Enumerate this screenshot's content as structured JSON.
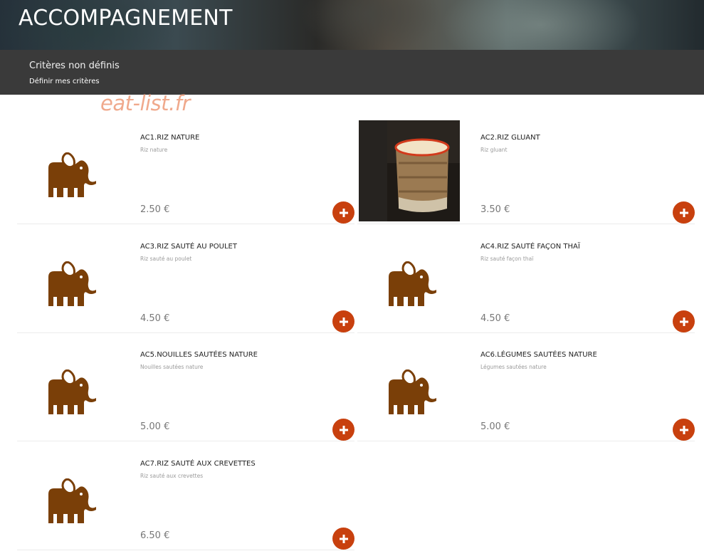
{
  "header": {
    "title": "ACCOMPAGNEMENT"
  },
  "criteria": {
    "title": "Critères non définis",
    "link": "Définir mes critères"
  },
  "watermark": "eat-list.fr",
  "colors": {
    "accent": "#c8400e",
    "elephant": "#7a3f08",
    "criteria_bar": "#3a3a3a"
  },
  "items": [
    {
      "name": "AC1.RIZ NATURE",
      "description": "Riz nature",
      "price": "2.50 €",
      "image": "elephant-logo-icon"
    },
    {
      "name": "AC2.RIZ GLUANT",
      "description": "Riz gluant",
      "price": "3.50 €",
      "image": "sticky-rice-basket-photo"
    },
    {
      "name": "AC3.RIZ SAUTÉ AU POULET",
      "description": "Riz sauté au poulet",
      "price": "4.50 €",
      "image": "elephant-logo-icon"
    },
    {
      "name": "AC4.RIZ SAUTÉ FAÇON THAÏ",
      "description": "Riz sauté façon thaï",
      "price": "4.50 €",
      "image": "elephant-logo-icon"
    },
    {
      "name": "AC5.NOUILLES SAUTÉES NATURE",
      "description": "Nouilles sautées nature",
      "price": "5.00 €",
      "image": "elephant-logo-icon"
    },
    {
      "name": "AC6.LÉGUMES SAUTÉES NATURE",
      "description": "Légumes sautées nature",
      "price": "5.00 €",
      "image": "elephant-logo-icon"
    },
    {
      "name": "AC7.RIZ SAUTÉ AUX CREVETTES",
      "description": "Riz sauté aux crevettes",
      "price": "6.50 €",
      "image": "elephant-logo-icon"
    }
  ]
}
